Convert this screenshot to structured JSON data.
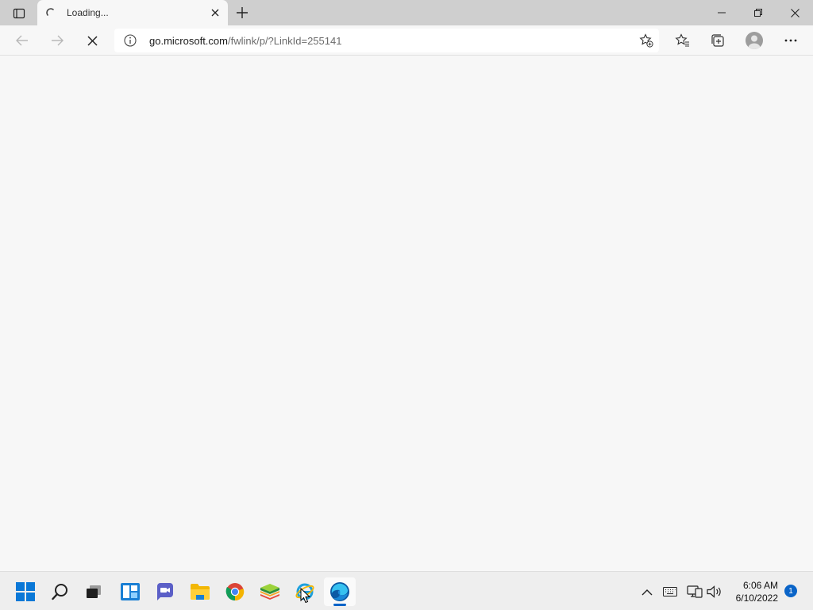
{
  "browser": {
    "tab": {
      "title": "Loading...",
      "state": "loading"
    },
    "address": {
      "url_host": "go.microsoft.com",
      "url_path": "/fwlink/p/?LinkId=255141"
    },
    "toolbar_icons": [
      "back-icon",
      "forward-icon",
      "stop-icon",
      "site-info-icon",
      "add-favorite-icon",
      "favorites-icon",
      "collections-icon",
      "profile-avatar",
      "more-icon"
    ]
  },
  "window_controls": [
    "minimize-icon",
    "restore-icon",
    "close-icon"
  ],
  "taskbar": {
    "apps": [
      {
        "name": "start",
        "icon": "windows-logo-icon"
      },
      {
        "name": "search",
        "icon": "search-icon"
      },
      {
        "name": "task-view",
        "icon": "task-view-icon"
      },
      {
        "name": "widgets",
        "icon": "widgets-icon"
      },
      {
        "name": "chat",
        "icon": "teams-chat-icon"
      },
      {
        "name": "file-explorer",
        "icon": "folder-icon"
      },
      {
        "name": "chrome",
        "icon": "chrome-icon"
      },
      {
        "name": "bluestacks",
        "icon": "bluestacks-icon"
      },
      {
        "name": "internet-explorer",
        "icon": "internet-explorer-icon"
      },
      {
        "name": "edge",
        "icon": "edge-icon",
        "running": true
      }
    ],
    "tray_icons": [
      "chevron-up-icon",
      "keyboard-icon",
      "network-icon",
      "volume-icon"
    ],
    "clock": {
      "time": "6:06 AM",
      "date": "6/10/2022"
    },
    "notification_count": "1"
  },
  "colors": {
    "titlebar": "#cfcfcf",
    "page_bg": "#f7f7f7",
    "accent": "#0a64c8"
  }
}
